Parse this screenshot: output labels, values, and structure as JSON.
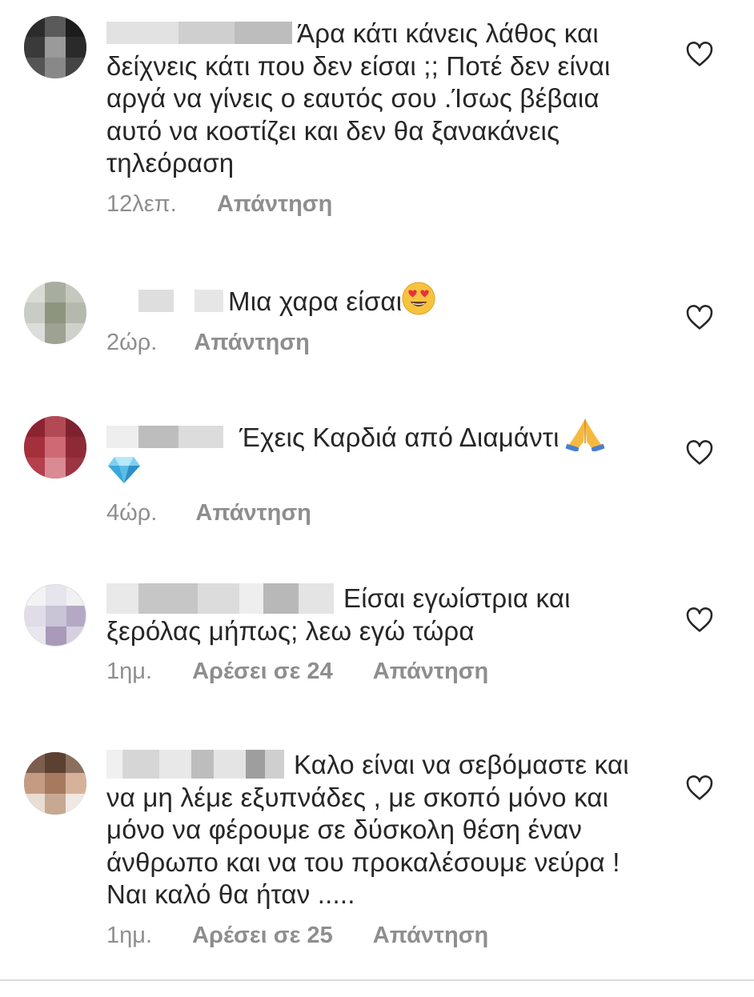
{
  "comments": [
    {
      "text": "Άρα κάτι κάνεις λάθος και δείχνεις κάτι που δεν είσαι ;; Ποτέ δεν είναι αργά να γίνεις ο εαυτός σου .Ίσως βέβαια αυτό να  κοστίζει και δεν θα ξανακάνεις τηλεόραση",
      "time": "12λεπ.",
      "likes": "",
      "reply": "Απάντηση"
    },
    {
      "text": "Μια χαρα είσαι",
      "emoji": "heart-eyes-emoji",
      "time": "2ώρ.",
      "likes": "",
      "reply": "Απάντηση"
    },
    {
      "text": "Έχεις Καρδιά από Διαμάντι",
      "emoji": "folded-hands-emoji",
      "emoji2": "gem-emoji",
      "time": "4ώρ.",
      "likes": "",
      "reply": "Απάντηση"
    },
    {
      "text": "Είσαι εγωίστρια και ξερόλας μήπως;  λεω εγώ τώρα",
      "time": "1ημ.",
      "likes": "Αρέσει σε 24",
      "reply": "Απάντηση"
    },
    {
      "text": "Καλο είναι να σεβόμαστε και να μη λέμε εξυπνάδες , με σκοπό μόνο και μόνο να φέρουμε σε δύσκολη θέση έναν άνθρωπο και να του προκαλέσουμε νεύρα ! Ναι καλό θα ήταν .....",
      "time": "1ημ.",
      "likes": "Αρέσει σε 25",
      "reply": "Απάντηση"
    }
  ],
  "icons": {
    "like": "heart-outline-icon"
  },
  "colors": {
    "text": "#262626",
    "meta": "#8e8e8e"
  }
}
